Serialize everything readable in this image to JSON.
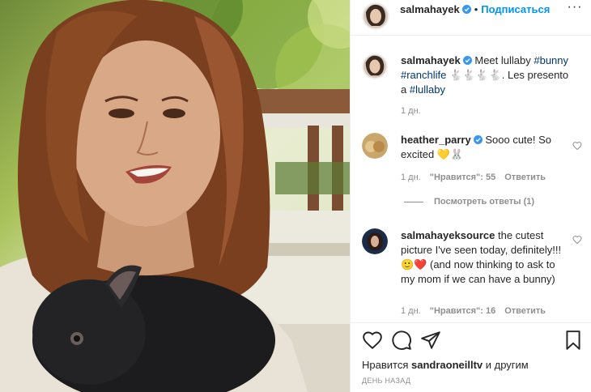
{
  "header": {
    "username": "salmahayek",
    "follow_label": "Подписаться",
    "more_label": "···"
  },
  "caption": {
    "username": "salmahayek",
    "text_before": "Meet lullaby",
    "tag1": "#bunny",
    "tag2": "#ranchlife",
    "emojis": "🐇🐇🐇🐇",
    "text_after": ". Les presento a",
    "tag3": "#lullaby",
    "time": "1 дн."
  },
  "comments": [
    {
      "username": "heather_parry",
      "text": "Sooo cute! So excited 💛🐰",
      "time": "1 дн.",
      "likes": "\"Нравится\": 55",
      "reply_label": "Ответить"
    },
    {
      "username": "salmahayeksource",
      "text": "the cutest picture I've seen today, definitely!!! 🙂❤️ (and now thinking to ask to my mom if we can have a bunny)",
      "time": "1 дн.",
      "likes": "\"Нравится\": 16",
      "reply_label": "Ответить"
    }
  ],
  "view_replies": "Посмотреть ответы (1)",
  "likes_line": {
    "prefix": "Нравится",
    "user": "sandraoneilltv",
    "suffix": "и другим"
  },
  "date": "ДЕНЬ НАЗАД",
  "icons": {
    "like": "heart-icon",
    "comment": "comment-icon",
    "share": "share-icon",
    "save": "bookmark-icon",
    "verified": "verified-badge-icon"
  },
  "colors": {
    "link": "#0095f6",
    "hashtag": "#00376b",
    "muted": "#8e8e8e"
  }
}
